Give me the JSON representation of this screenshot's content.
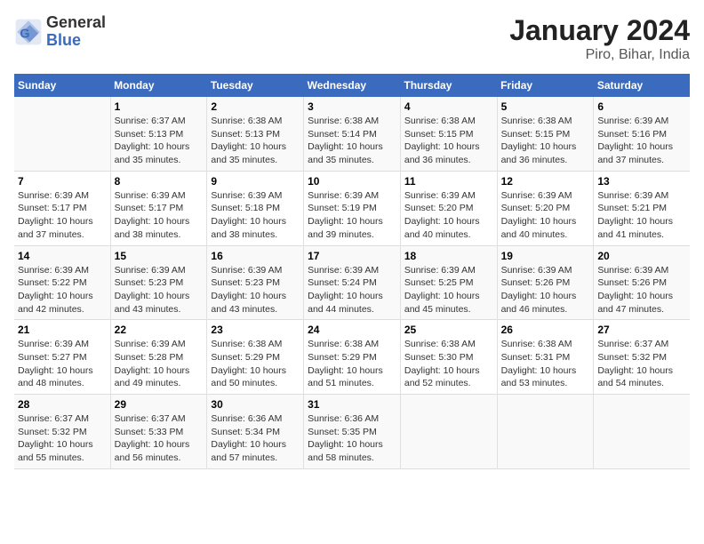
{
  "header": {
    "logo_line1": "General",
    "logo_line2": "Blue",
    "title": "January 2024",
    "subtitle": "Piro, Bihar, India"
  },
  "calendar": {
    "headers": [
      "Sunday",
      "Monday",
      "Tuesday",
      "Wednesday",
      "Thursday",
      "Friday",
      "Saturday"
    ],
    "weeks": [
      [
        {
          "day": "",
          "info": ""
        },
        {
          "day": "1",
          "info": "Sunrise: 6:37 AM\nSunset: 5:13 PM\nDaylight: 10 hours\nand 35 minutes."
        },
        {
          "day": "2",
          "info": "Sunrise: 6:38 AM\nSunset: 5:13 PM\nDaylight: 10 hours\nand 35 minutes."
        },
        {
          "day": "3",
          "info": "Sunrise: 6:38 AM\nSunset: 5:14 PM\nDaylight: 10 hours\nand 35 minutes."
        },
        {
          "day": "4",
          "info": "Sunrise: 6:38 AM\nSunset: 5:15 PM\nDaylight: 10 hours\nand 36 minutes."
        },
        {
          "day": "5",
          "info": "Sunrise: 6:38 AM\nSunset: 5:15 PM\nDaylight: 10 hours\nand 36 minutes."
        },
        {
          "day": "6",
          "info": "Sunrise: 6:39 AM\nSunset: 5:16 PM\nDaylight: 10 hours\nand 37 minutes."
        }
      ],
      [
        {
          "day": "7",
          "info": "Sunrise: 6:39 AM\nSunset: 5:17 PM\nDaylight: 10 hours\nand 37 minutes."
        },
        {
          "day": "8",
          "info": "Sunrise: 6:39 AM\nSunset: 5:17 PM\nDaylight: 10 hours\nand 38 minutes."
        },
        {
          "day": "9",
          "info": "Sunrise: 6:39 AM\nSunset: 5:18 PM\nDaylight: 10 hours\nand 38 minutes."
        },
        {
          "day": "10",
          "info": "Sunrise: 6:39 AM\nSunset: 5:19 PM\nDaylight: 10 hours\nand 39 minutes."
        },
        {
          "day": "11",
          "info": "Sunrise: 6:39 AM\nSunset: 5:20 PM\nDaylight: 10 hours\nand 40 minutes."
        },
        {
          "day": "12",
          "info": "Sunrise: 6:39 AM\nSunset: 5:20 PM\nDaylight: 10 hours\nand 40 minutes."
        },
        {
          "day": "13",
          "info": "Sunrise: 6:39 AM\nSunset: 5:21 PM\nDaylight: 10 hours\nand 41 minutes."
        }
      ],
      [
        {
          "day": "14",
          "info": "Sunrise: 6:39 AM\nSunset: 5:22 PM\nDaylight: 10 hours\nand 42 minutes."
        },
        {
          "day": "15",
          "info": "Sunrise: 6:39 AM\nSunset: 5:23 PM\nDaylight: 10 hours\nand 43 minutes."
        },
        {
          "day": "16",
          "info": "Sunrise: 6:39 AM\nSunset: 5:23 PM\nDaylight: 10 hours\nand 43 minutes."
        },
        {
          "day": "17",
          "info": "Sunrise: 6:39 AM\nSunset: 5:24 PM\nDaylight: 10 hours\nand 44 minutes."
        },
        {
          "day": "18",
          "info": "Sunrise: 6:39 AM\nSunset: 5:25 PM\nDaylight: 10 hours\nand 45 minutes."
        },
        {
          "day": "19",
          "info": "Sunrise: 6:39 AM\nSunset: 5:26 PM\nDaylight: 10 hours\nand 46 minutes."
        },
        {
          "day": "20",
          "info": "Sunrise: 6:39 AM\nSunset: 5:26 PM\nDaylight: 10 hours\nand 47 minutes."
        }
      ],
      [
        {
          "day": "21",
          "info": "Sunrise: 6:39 AM\nSunset: 5:27 PM\nDaylight: 10 hours\nand 48 minutes."
        },
        {
          "day": "22",
          "info": "Sunrise: 6:39 AM\nSunset: 5:28 PM\nDaylight: 10 hours\nand 49 minutes."
        },
        {
          "day": "23",
          "info": "Sunrise: 6:38 AM\nSunset: 5:29 PM\nDaylight: 10 hours\nand 50 minutes."
        },
        {
          "day": "24",
          "info": "Sunrise: 6:38 AM\nSunset: 5:29 PM\nDaylight: 10 hours\nand 51 minutes."
        },
        {
          "day": "25",
          "info": "Sunrise: 6:38 AM\nSunset: 5:30 PM\nDaylight: 10 hours\nand 52 minutes."
        },
        {
          "day": "26",
          "info": "Sunrise: 6:38 AM\nSunset: 5:31 PM\nDaylight: 10 hours\nand 53 minutes."
        },
        {
          "day": "27",
          "info": "Sunrise: 6:37 AM\nSunset: 5:32 PM\nDaylight: 10 hours\nand 54 minutes."
        }
      ],
      [
        {
          "day": "28",
          "info": "Sunrise: 6:37 AM\nSunset: 5:32 PM\nDaylight: 10 hours\nand 55 minutes."
        },
        {
          "day": "29",
          "info": "Sunrise: 6:37 AM\nSunset: 5:33 PM\nDaylight: 10 hours\nand 56 minutes."
        },
        {
          "day": "30",
          "info": "Sunrise: 6:36 AM\nSunset: 5:34 PM\nDaylight: 10 hours\nand 57 minutes."
        },
        {
          "day": "31",
          "info": "Sunrise: 6:36 AM\nSunset: 5:35 PM\nDaylight: 10 hours\nand 58 minutes."
        },
        {
          "day": "",
          "info": ""
        },
        {
          "day": "",
          "info": ""
        },
        {
          "day": "",
          "info": ""
        }
      ]
    ]
  }
}
